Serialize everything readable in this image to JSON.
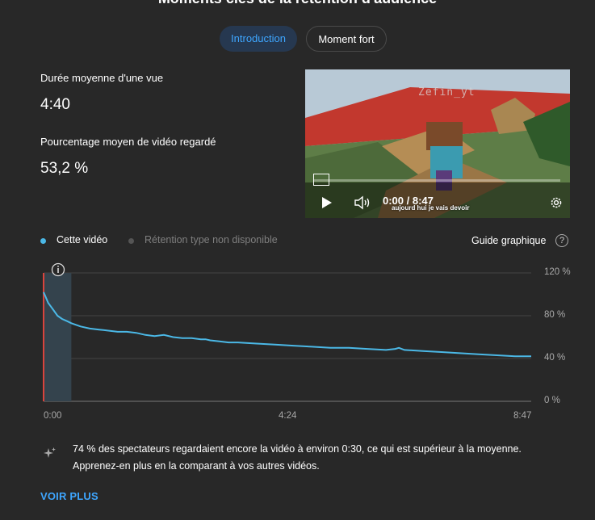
{
  "header": {
    "title": "Moments clés de la rétention d'audience"
  },
  "tabs": [
    {
      "label": "Introduction",
      "active": true
    },
    {
      "label": "Moment fort",
      "active": false
    }
  ],
  "stats": {
    "avg_duration_label": "Durée moyenne d'une vue",
    "avg_duration_value": "4:40",
    "avg_percent_label": "Pourcentage moyen de vidéo regardé",
    "avg_percent_value": "53,2 %"
  },
  "video_preview": {
    "watermark": "Zefin_yt",
    "time": "0:00 / 8:47",
    "subtitle": "aujourd hui je vais devoir",
    "icons": [
      "play-icon",
      "volume-icon",
      "settings-icon"
    ]
  },
  "legend": {
    "this_video": "Cette vidéo",
    "typical": "Rétention type non disponible",
    "guide": "Guide graphique"
  },
  "colors": {
    "accent": "#3ea6ff",
    "series": "#4bb8e6",
    "marker": "#d9443c",
    "background": "#282828"
  },
  "chart_data": {
    "type": "line",
    "x_ticks": [
      "0:00",
      "4:24",
      "8:47"
    ],
    "y_ticks": [
      "120 %",
      "80 %",
      "40 %",
      "0 %"
    ],
    "ylim": [
      0,
      120
    ],
    "xlim_seconds": [
      0,
      527
    ],
    "highlight_range_seconds": [
      0,
      30
    ],
    "series": [
      {
        "name": "Cette vidéo",
        "x": [
          0,
          5,
          10,
          15,
          20,
          25,
          30,
          40,
          50,
          60,
          70,
          80,
          90,
          100,
          110,
          120,
          130,
          140,
          150,
          160,
          170,
          175,
          180,
          190,
          200,
          210,
          230,
          250,
          270,
          290,
          310,
          330,
          350,
          370,
          380,
          384,
          390,
          410,
          430,
          450,
          470,
          490,
          510,
          527
        ],
        "y": [
          102,
          92,
          86,
          80,
          77,
          75,
          73,
          70,
          68,
          67,
          66,
          65,
          65,
          64,
          62,
          61,
          62,
          60,
          59,
          59,
          58,
          58,
          57,
          56,
          55,
          55,
          54,
          53,
          52,
          51,
          50,
          50,
          49,
          48,
          49,
          50,
          48,
          47,
          46,
          45,
          44,
          43,
          42,
          42
        ]
      }
    ]
  },
  "insight": {
    "text": "74 % des spectateurs regardaient encore la vidéo à environ 0:30, ce qui est supérieur à la moyenne. Apprenez-en plus en la comparant à vos autres vidéos."
  },
  "see_more": "VOIR PLUS"
}
